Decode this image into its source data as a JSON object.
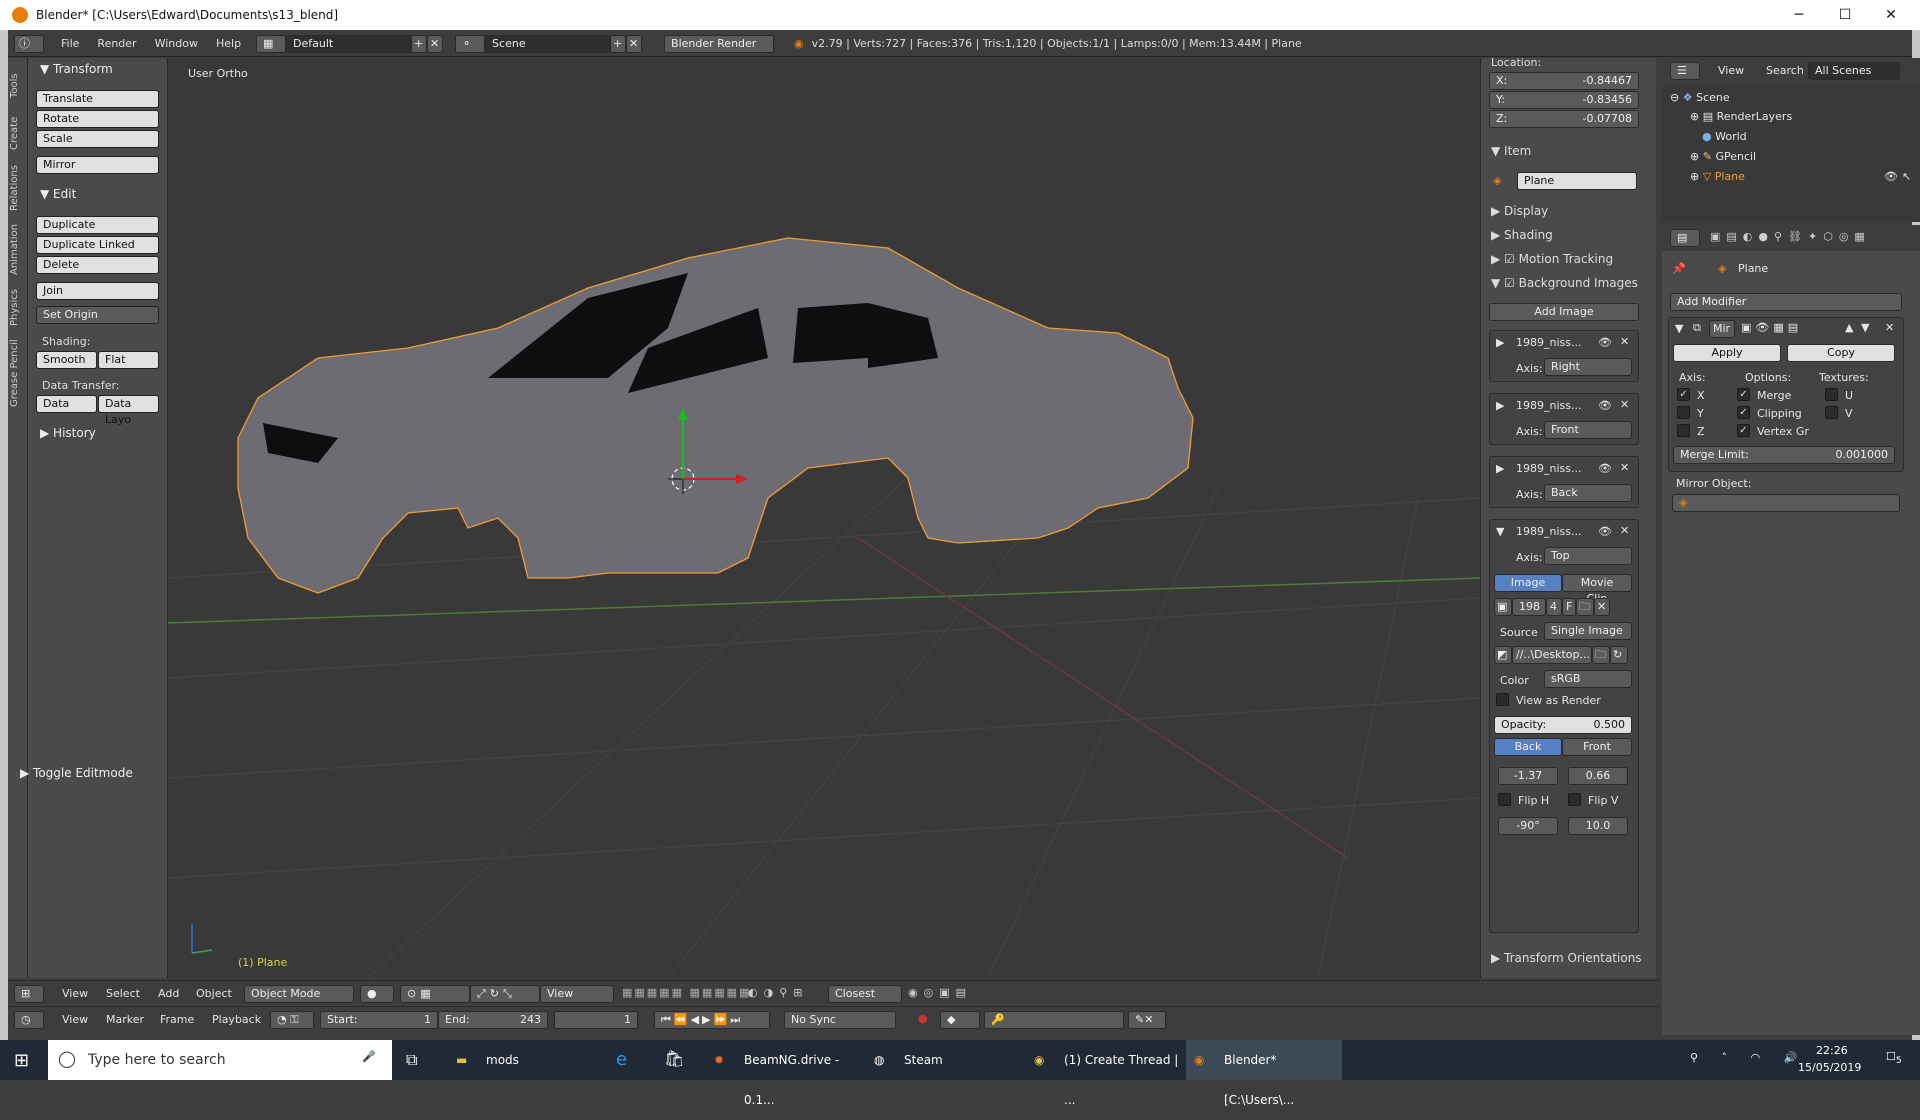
{
  "titlebar": {
    "title": "Blender* [C:\\Users\\Edward\\Documents\\s13_blend]",
    "minimize": "─",
    "maximize": "☐",
    "close": "✕"
  },
  "menubar": {
    "items": [
      "File",
      "Render",
      "Window",
      "Help"
    ],
    "layout": "Default",
    "scene": "Scene",
    "engine": "Blender Render",
    "stats": "v2.79 | Verts:727 | Faces:376 | Tris:1,120 | Objects:1/1 | Lamps:0/0 | Mem:13.44M | Plane"
  },
  "sidetabs": [
    "Tools",
    "Create",
    "Relations",
    "Animation",
    "Physics",
    "Grease Pencil"
  ],
  "toolshelf": {
    "transform_header": "Transform",
    "transform": [
      "Translate",
      "Rotate",
      "Scale"
    ],
    "mirror": "Mirror",
    "edit_header": "Edit",
    "edit": [
      "Duplicate",
      "Duplicate Linked",
      "Delete"
    ],
    "join": "Join",
    "set_origin": "Set Origin",
    "shading_label": "Shading:",
    "smooth": "Smooth",
    "flat": "Flat",
    "data_transfer_label": "Data Transfer:",
    "data": "Data",
    "data_layout": "Data Layo",
    "history": "History",
    "toggle_editmode": "Toggle Editmode"
  },
  "viewport": {
    "label": "User Ortho",
    "object_label": "(1) Plane"
  },
  "npanel": {
    "location_label": "Location:",
    "x": "X:",
    "x_val": "-0.84467",
    "y": "Y:",
    "y_val": "-0.83456",
    "z": "Z:",
    "z_val": "-0.07708",
    "item_header": "Item",
    "item_name": "Plane",
    "display": "Display",
    "shading": "Shading",
    "motion_tracking": "Motion Tracking",
    "background_images": "Background Images",
    "add_image": "Add Image",
    "bg_images": [
      {
        "name": "1989_niss...",
        "axis": "Right"
      },
      {
        "name": "1989_niss...",
        "axis": "Front"
      },
      {
        "name": "1989_niss...",
        "axis": "Back"
      },
      {
        "name": "1989_niss...",
        "axis": "Top"
      }
    ],
    "axis_label": "Axis:",
    "image_tab": "Image",
    "movie_clip_tab": "Movie Clip",
    "img_num": "198",
    "img_users": "4",
    "img_f": "F",
    "source_label": "Source",
    "source_value": "Single Image",
    "filepath": "//..\\Desktop...",
    "color_label": "Color",
    "color_value": "sRGB",
    "view_as_render": "View as Render",
    "opacity_label": "Opacity:",
    "opacity_value": "0.500",
    "back": "Back",
    "front": "Front",
    "offset_x": "-1.37",
    "offset_y": "0.66",
    "flip_h": "Flip H",
    "flip_v": "Flip V",
    "rotation": "-90°",
    "size": "10.0",
    "transform_orientations": "Transform Orientations"
  },
  "outliner": {
    "view": "View",
    "search": "Search",
    "all_scenes": "All Scenes",
    "tree": [
      "Scene",
      "RenderLayers",
      "World",
      "GPencil",
      "Plane"
    ]
  },
  "properties": {
    "object": "Plane",
    "add_modifier": "Add Modifier",
    "modifier_name": "Mir",
    "apply": "Apply",
    "copy": "Copy",
    "axis_label": "Axis:",
    "options_label": "Options:",
    "textures_label": "Textures:",
    "x": "X",
    "y": "Y",
    "z": "Z",
    "merge": "Merge",
    "clipping": "Clipping",
    "vertex_gr": "Vertex Gr",
    "u": "U",
    "v": "V",
    "merge_limit_label": "Merge Limit:",
    "merge_limit_value": "0.001000",
    "mirror_object": "Mirror Object:"
  },
  "bottom1": {
    "view": "View",
    "select": "Select",
    "add": "Add",
    "object": "Object",
    "mode": "Object Mode",
    "view2": "View",
    "snap": "Closest"
  },
  "bottom2": {
    "view": "View",
    "marker": "Marker",
    "frame": "Frame",
    "playback": "Playback",
    "start_label": "Start:",
    "start": "1",
    "end_label": "End:",
    "end": "243",
    "current": "1",
    "sync": "No Sync"
  },
  "taskbar": {
    "search": "Type here to search",
    "apps": [
      "mods",
      "BeamNG.drive - 0.1...",
      "Steam",
      "(1) Create Thread | ...",
      "Blender* [C:\\Users\\..."
    ],
    "time": "22:26",
    "date": "15/05/2019",
    "notif": "5"
  },
  "colors": {
    "accent": "#5680c2",
    "orange": "#e87d0d",
    "selected_outline": "#f19c33"
  }
}
